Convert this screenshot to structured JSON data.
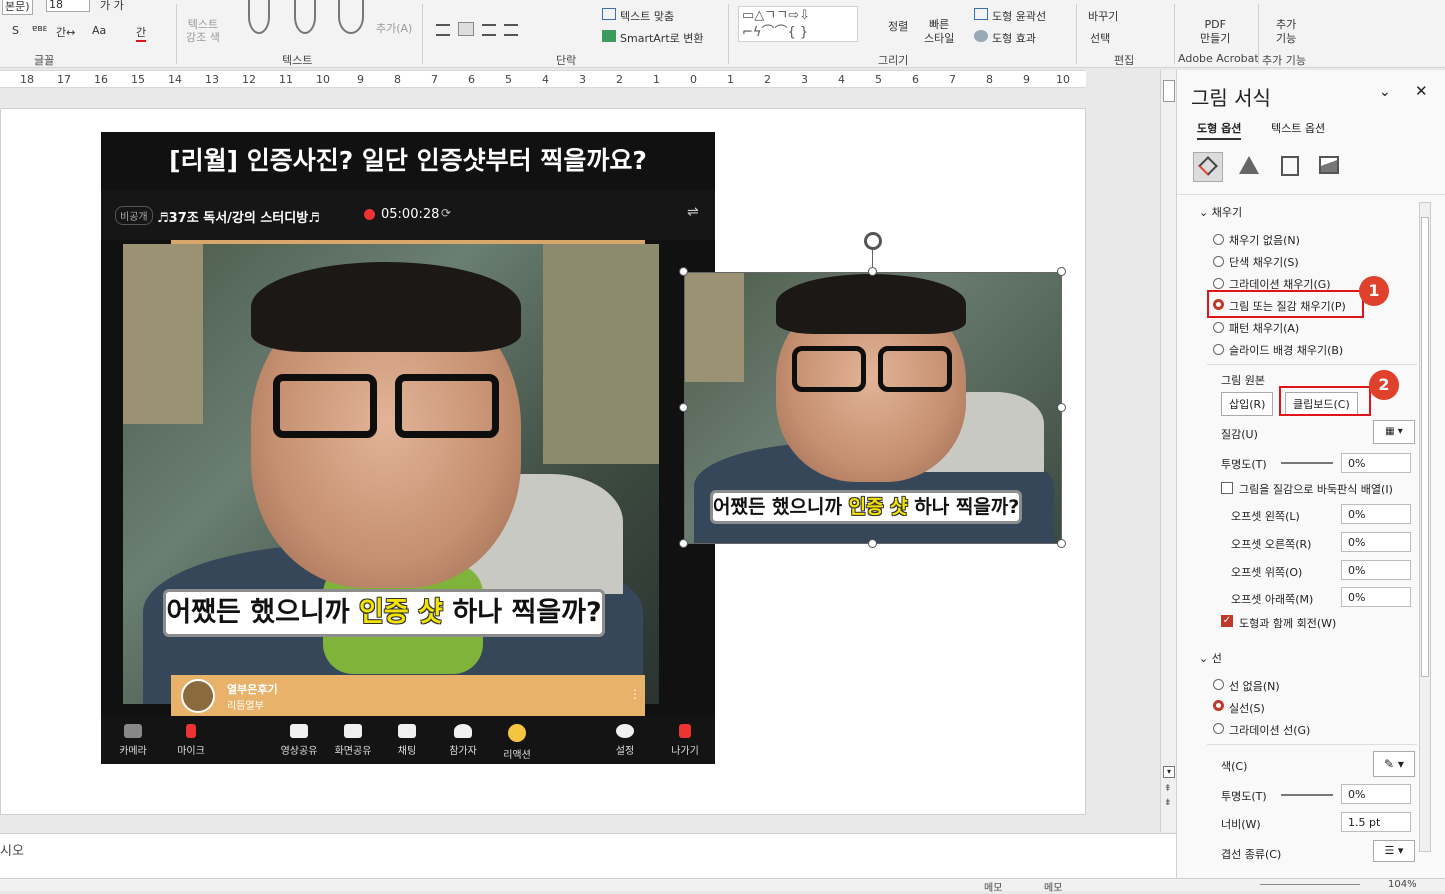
{
  "ribbon": {
    "font_name": "본문)",
    "font_size": "18",
    "bold_italic": "가 가",
    "row2_items": [
      "S",
      "ɐʙᴇ",
      "간↔",
      "Aa",
      "간"
    ],
    "text_highlight": "텍스트\n강조 색",
    "add_in": "추가(A)",
    "text_fit": "텍스트 맞춤",
    "smartart": "SmartArt로 변환",
    "arrange": "정렬",
    "quick_styles": "빠른\n스타일",
    "shape_outline": "도형 윤곽선",
    "shape_effects": "도형 효과",
    "replace": "바꾸기",
    "select": "선택",
    "pdf": "PDF\n만들기",
    "addins": "추가\n기능",
    "groups": {
      "font": "글꼴",
      "text": "텍스트",
      "paragraph": "단락",
      "drawing": "그리기",
      "editing": "편집",
      "acrobat": "Adobe Acrobat",
      "addin": "추가 기능"
    }
  },
  "ruler": {
    "numbers": [
      "18",
      "17",
      "16",
      "15",
      "14",
      "13",
      "12",
      "11",
      "10",
      "9",
      "8",
      "7",
      "6",
      "5",
      "4",
      "3",
      "2",
      "1",
      "0",
      "1",
      "2",
      "3",
      "4",
      "5",
      "6",
      "7",
      "8",
      "9",
      "10"
    ]
  },
  "slide": {
    "screenshot_title": "[리월] 인증사진? 일단 인증샷부터 찍을까요?",
    "room_tag": "비공개",
    "room_name": "♬37조 독서/강의 스터디방♬",
    "timer": "05:00:28",
    "subtitle_pre": "어쨌든 했으니까 ",
    "subtitle_hl": "인증 샷",
    "subtitle_post": " 하나 찍을까?",
    "host_name": "열부은후기",
    "host_sub": "리듬열부",
    "tools": [
      "카메라",
      "마이크",
      "영상공유",
      "화면공유",
      "채팅",
      "참가자",
      "리액션",
      "설정",
      "나가기"
    ]
  },
  "notes": {
    "text": "시오"
  },
  "pane": {
    "title": "그림 서식",
    "tab_shape": "도형 옵션",
    "tab_text": "텍스트 옵션",
    "fill_section": "채우기",
    "fill_options": [
      "채우기 없음(N)",
      "단색 채우기(S)",
      "그라데이션 채우기(G)",
      "그림 또는 질감 채우기(P)",
      "패턴 채우기(A)",
      "슬라이드 배경 채우기(B)"
    ],
    "picture_source": "그림 원본",
    "insert_btn": "삽입(R)",
    "clipboard_btn": "클립보드(C)",
    "texture": "질감(U)",
    "transparency": "투명도(T)",
    "transparency_val": "0%",
    "tile_check": "그림을 질감으로 바둑판식 배열(I)",
    "offset_left": "오프셋 왼쪽(L)",
    "offset_right": "오프셋 오른쪽(R)",
    "offset_top": "오프셋 위쪽(O)",
    "offset_bottom": "오프셋 아래쪽(M)",
    "offset_val": "0%",
    "rotate_check": "도형과 함께 회전(W)",
    "line_section": "선",
    "line_options": [
      "선 없음(N)",
      "실선(S)",
      "그라데이션 선(G)"
    ],
    "color": "색(C)",
    "line_transparency": "투명도(T)",
    "line_transparency_val": "0%",
    "width": "너비(W)",
    "width_val": "1.5 pt",
    "compound": "겹선 종류(C)",
    "badge1": "1",
    "badge2": "2"
  },
  "status": {
    "memo1": "메모",
    "memo2": "메모",
    "zoom": "104%"
  },
  "colors": {
    "accent_red": "#e0141a",
    "badge": "#e0412c",
    "ribbon": "#f3f3f3"
  }
}
